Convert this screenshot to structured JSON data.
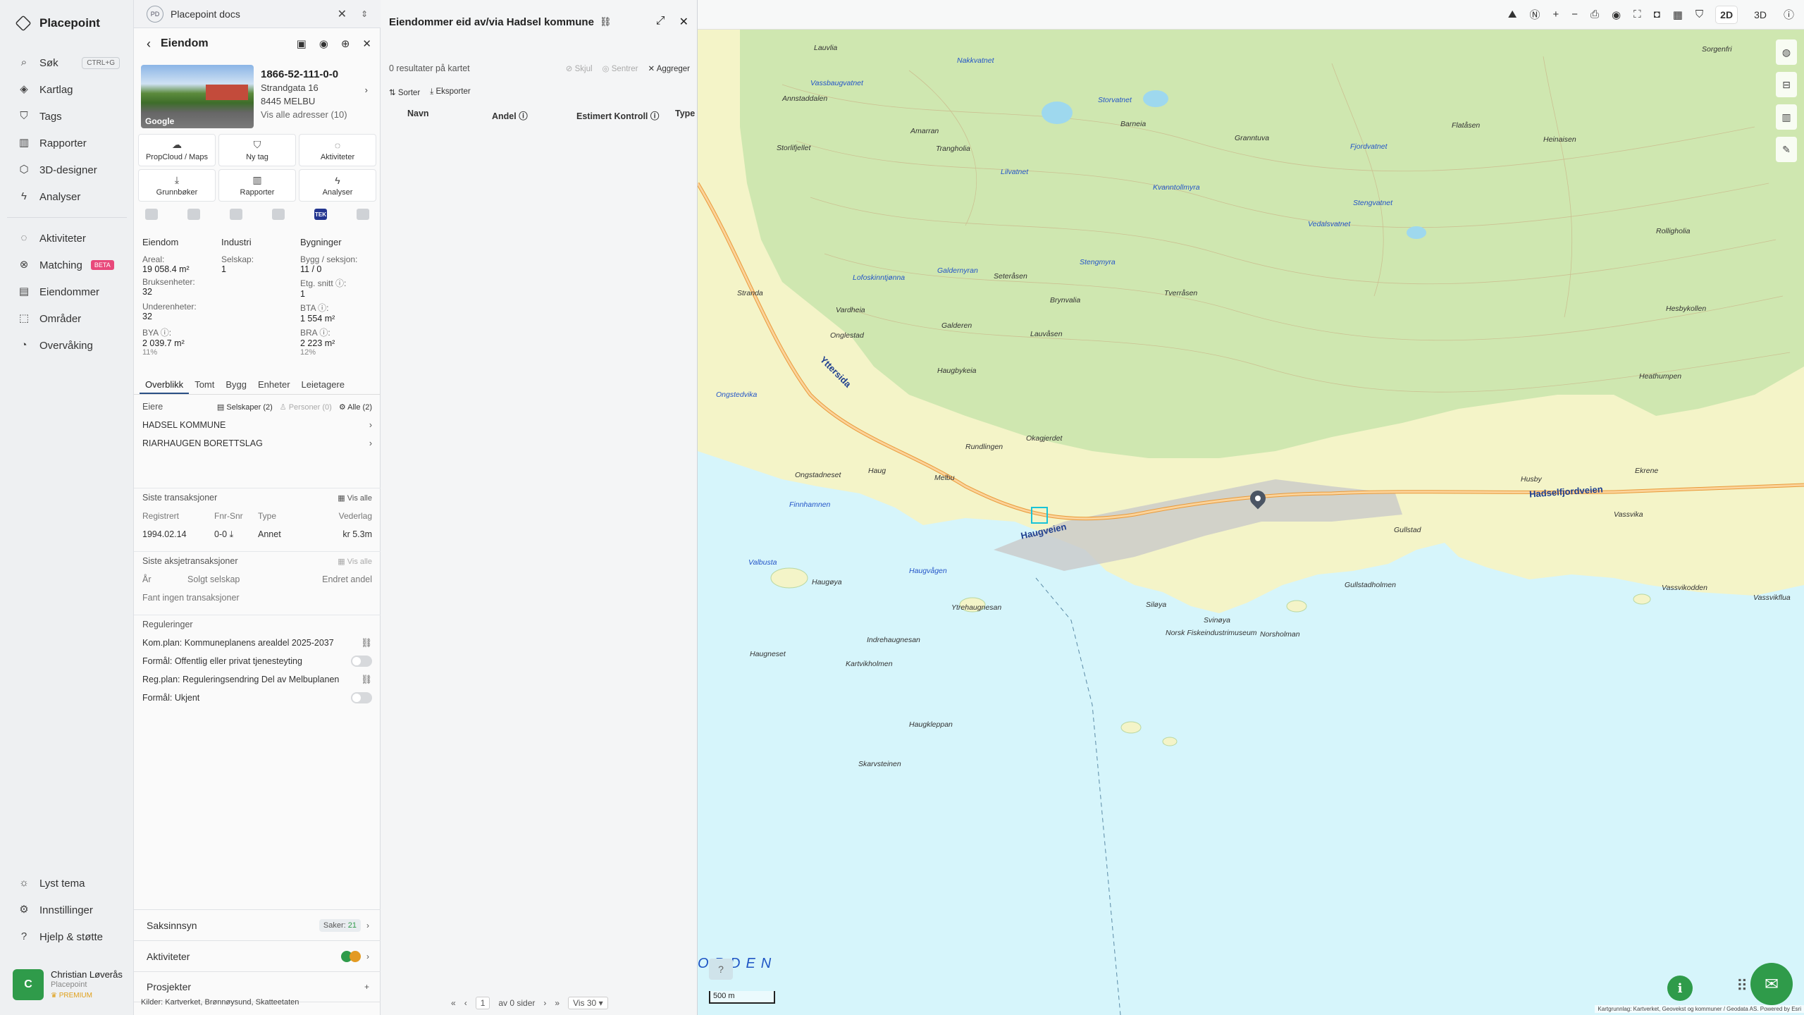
{
  "app": {
    "name": "Placepoint",
    "nav": [
      {
        "label": "Søk",
        "icon": "search-icon",
        "shortcut": "CTRL+G"
      },
      {
        "label": "Kartlag",
        "icon": "layers-icon"
      },
      {
        "label": "Tags",
        "icon": "bookmark-icon"
      },
      {
        "label": "Rapporter",
        "icon": "bar-chart-icon"
      },
      {
        "label": "3D-designer",
        "icon": "cube-icon"
      },
      {
        "label": "Analyser",
        "icon": "bolt-icon"
      }
    ],
    "nav2": [
      {
        "label": "Aktiviteter",
        "icon": "chat-icon"
      },
      {
        "label": "Matching",
        "icon": "matching-icon",
        "badge": "BETA"
      },
      {
        "label": "Eiendommer",
        "icon": "building-icon"
      },
      {
        "label": "Områder",
        "icon": "area-icon"
      },
      {
        "label": "Overvåking",
        "icon": "watch-icon"
      }
    ],
    "footer_nav": [
      {
        "label": "Lyst tema",
        "icon": "sun-icon"
      },
      {
        "label": "Innstillinger",
        "icon": "gear-icon"
      },
      {
        "label": "Hjelp & støtte",
        "icon": "help-icon"
      }
    ],
    "user": {
      "initial": "C",
      "name": "Christian Løverås",
      "company": "Placepoint",
      "plan": "PREMIUM"
    }
  },
  "docs_tab": {
    "badge": "PD",
    "title": "Placepoint docs"
  },
  "property": {
    "header": "Eiendom",
    "id": "1866-52-111-0-0",
    "street": "Strandgata 16",
    "postal": "8445 MELBU",
    "all_addresses": "Vis alle adresser (10)",
    "photo_label": "Google",
    "actions": [
      {
        "label": "PropCloud / Maps",
        "icon": "cloud-icon"
      },
      {
        "label": "Ny tag",
        "icon": "bookmark-icon"
      },
      {
        "label": "Aktiviteter",
        "icon": "chat-icon"
      },
      {
        "label": "Grunnbøker",
        "icon": "download-icon"
      },
      {
        "label": "Rapporter",
        "icon": "bar-chart-icon"
      },
      {
        "label": "Analyser",
        "icon": "bolt-icon"
      }
    ],
    "source_tek": "TEK",
    "facts": {
      "col1_title": "Eiendom",
      "col2_title": "Industri",
      "col3_title": "Bygninger",
      "areal_label": "Areal:",
      "areal_value": "19 058.4 m²",
      "selskap_label": "Selskap:",
      "selskap_value": "1",
      "bygg_label": "Bygg / seksjon:",
      "bygg_value": "11 / 0",
      "bruk_label": "Bruksenheter:",
      "bruk_value": "32",
      "etg_label": "Etg. snitt ⓘ:",
      "etg_value": "1",
      "under_label": "Underenheter:",
      "under_value": "32",
      "bta_label": "BTA ⓘ:",
      "bta_value": "1 554 m²",
      "bya_label": "BYA ⓘ:",
      "bya_value": "2 039.7 m²",
      "bya_pct": "11%",
      "bra_label": "BRA ⓘ:",
      "bra_value": "2 223 m²",
      "bra_pct": "12%"
    },
    "tabs": [
      "Overblikk",
      "Tomt",
      "Bygg",
      "Enheter",
      "Leietagere"
    ],
    "owners": {
      "title": "Eiere",
      "chip_companies": "Selskaper (2)",
      "chip_persons": "Personer (0)",
      "chip_all": "Alle (2)",
      "list": [
        "HADSEL KOMMUNE",
        "RIARHAUGEN BORETTSLAG"
      ]
    },
    "transactions": {
      "title": "Siste transaksjoner",
      "show_all": "Vis alle",
      "headers": [
        "Registrert",
        "Fnr-Snr",
        "Type",
        "Vederlag"
      ],
      "row": [
        "1994.02.14",
        "0-0",
        "Annet",
        "kr 5.3m"
      ]
    },
    "share_tx": {
      "title": "Siste aksjetransaksjoner",
      "show_all": "Vis alle",
      "headers": [
        "År",
        "Solgt selskap",
        "Endret andel"
      ],
      "empty": "Fant ingen transaksjoner"
    },
    "regulations": {
      "title": "Reguleringer",
      "items": [
        "Kom.plan: Kommuneplanens arealdel 2025-2037",
        "Formål: Offentlig eller privat tjenesteyting",
        "Reg.plan: Reguleringsendring Del av Melbuplanen",
        "Formål: Ukjent"
      ]
    },
    "bottom": {
      "saksinnsyn": "Saksinnsyn",
      "saker_label": "Saker:",
      "saker_count": "21",
      "aktiviteter": "Aktiviteter",
      "prosjekter": "Prosjekter"
    },
    "sources_footer": "Kilder: Kartverket, Brønnøysund, Skatteetaten"
  },
  "results": {
    "title": "Eiendommer eid av/via Hadsel kommune",
    "count_text": "0 resultater på kartet",
    "actions": {
      "hide": "Skjul",
      "center": "Sentrer",
      "aggregate": "Aggreger",
      "sort": "Sorter",
      "export": "Eksporter"
    },
    "columns": [
      "Navn",
      "Andel ⓘ",
      "Estimert Kontroll ⓘ",
      "Type"
    ],
    "pager": {
      "page": "1",
      "of": "av 0 sider",
      "per_page": "Vis 30"
    }
  },
  "map": {
    "modes": [
      "2D",
      "3D"
    ],
    "scale": "500 m",
    "fjord_label": "ORDEN",
    "attribution": "Kartgrunnlag: Kartverket, Geovekst og kommuner / Geodata AS. Powered by Esri",
    "road_names": [
      "Hadselfjordveien",
      "Haugveien",
      "Yttersida"
    ],
    "labels": [
      "Sorgenfri",
      "Lauvlia",
      "Nakkvatnet",
      "Vassbaugvatnet",
      "Annstaddalen",
      "Amarran",
      "Storlifjellet",
      "Trangholia",
      "Barneia",
      "Granntuva",
      "Storvatnet",
      "Flatåsen",
      "Heinaisen",
      "Fjordvatnet",
      "Lilvatnet",
      "Kvanntollmyra",
      "Stengvatnet",
      "Vedalsvatnet",
      "Rolligholia",
      "Stranda",
      "Lofoskinntjønna",
      "Galdernyran",
      "Seteråsen",
      "Stengmyra",
      "Tverråsen",
      "Hesbykollen",
      "Vardheia",
      "Galderen",
      "Brynvalia",
      "Lauvåsen",
      "Onglestad",
      "Haugbykeia",
      "Heathumpen",
      "Ongstedvika",
      "Rundlingen",
      "Okagjerdet",
      "Haug",
      "Melbu",
      "Ongstadneset",
      "Ekrene",
      "Finnhamnen",
      "Husby",
      "Vassvika",
      "Gullstad",
      "Haugvågen",
      "Valbusta",
      "Haugøya",
      "Gullstadholmen",
      "Vassvikodden",
      "Vassvikflua",
      "Ytrehaugnesan",
      "Siløya",
      "Svinøya",
      "Norsk Fiskeindustrimuseum",
      "Norsholman",
      "Indrehaugnesan",
      "Haugneset",
      "Kartvikholmen",
      "Haugkleppan",
      "Skarvsteinen"
    ]
  }
}
